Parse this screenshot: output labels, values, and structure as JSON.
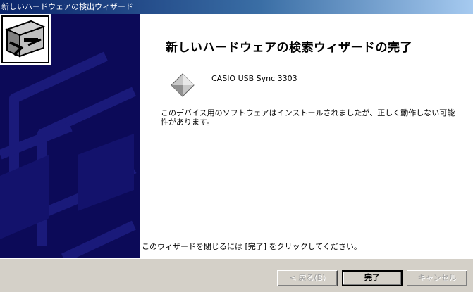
{
  "window": {
    "title": "新しいハードウェアの検出ウィザード"
  },
  "content": {
    "heading": "新しいハードウェアの検索ウィザードの完了",
    "device_name": "CASIO USB Sync 3303",
    "device_icon": "device-diamond-icon",
    "warning_text": "このデバイス用のソフトウェアはインストールされましたが、正しく動作しない可能性があります。",
    "instruction_text": "このウィザードを閉じるには [完了] をクリックしてください。"
  },
  "footer": {
    "back_label": "< 戻る(B)",
    "finish_label": "完了",
    "cancel_label": "キャンセル"
  },
  "colors": {
    "sidebar": "#0c0a58",
    "titlebar_start": "#0a246a",
    "titlebar_end": "#a6caf0",
    "button_face": "#d4d0c8"
  }
}
